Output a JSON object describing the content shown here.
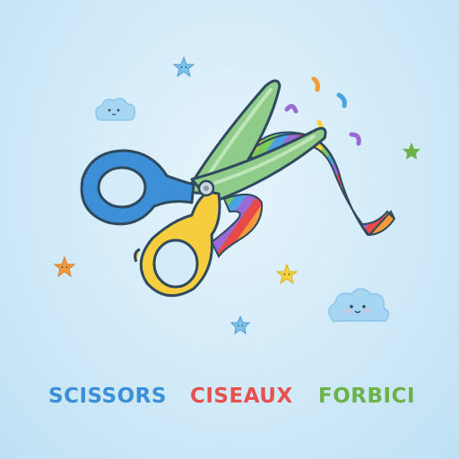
{
  "words": {
    "english": "SCISSORS",
    "french": "CISEAUX",
    "italian": "FORBICI"
  },
  "colors": {
    "background": "#d4ecf9",
    "english_text": "#3b8fd6",
    "french_text": "#e8504e",
    "italian_text": "#6bb24a",
    "blade": "#8fcc8a",
    "handle_blue": "#3d8fd8",
    "handle_yellow": "#f6cd3c",
    "outline": "#2f4a5e"
  },
  "ribbon_colors": [
    "#e84a4a",
    "#f39a3b",
    "#f6d23e",
    "#7cc95a",
    "#4aa3e0",
    "#9a6ad6"
  ],
  "icons": [
    "star-icon",
    "cloud-icon",
    "confetti-icon"
  ]
}
